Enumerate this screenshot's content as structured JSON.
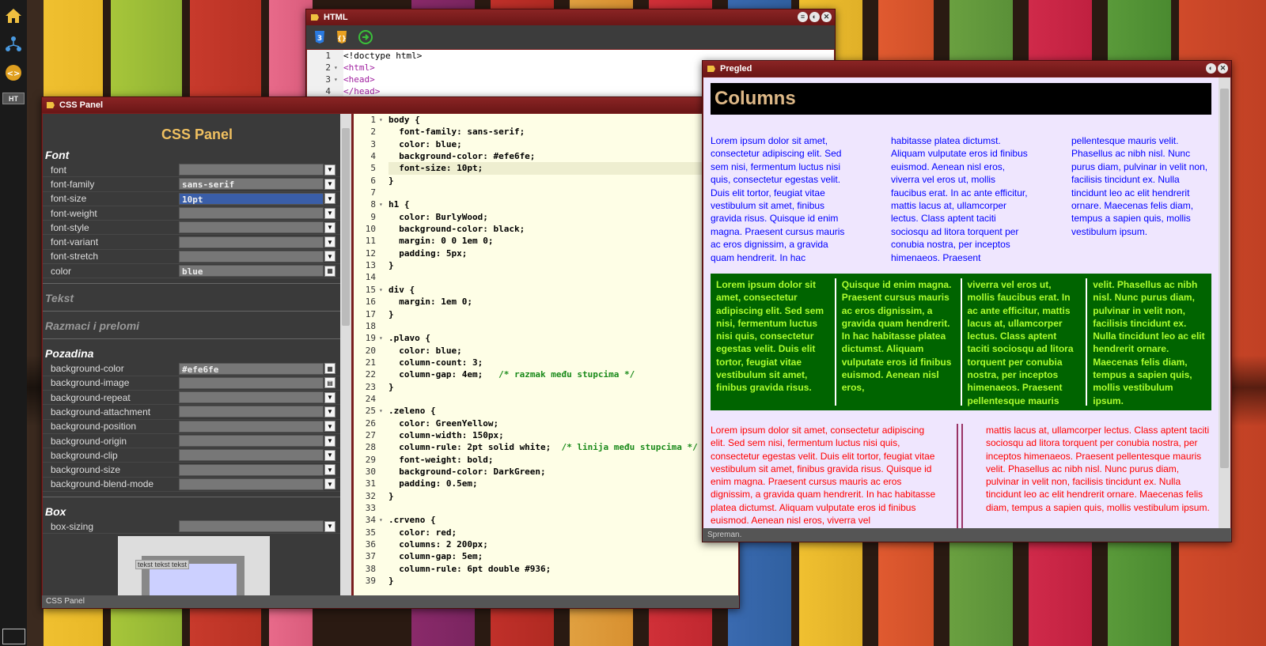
{
  "windows": {
    "html_title": "HTML",
    "css_title": "CSS Panel",
    "preview_title": "Pregled"
  },
  "dock": {
    "ht_label": "HT"
  },
  "html_editor": {
    "lines": [
      "<!doctype html>",
      "<html>",
      "<head>",
      "</head>"
    ]
  },
  "css_panel": {
    "heading": "CSS Panel",
    "font_section": "Font",
    "font_props": [
      {
        "label": "font",
        "value": ""
      },
      {
        "label": "font-family",
        "value": "sans-serif"
      },
      {
        "label": "font-size",
        "value": "10pt"
      },
      {
        "label": "font-weight",
        "value": ""
      },
      {
        "label": "font-style",
        "value": ""
      },
      {
        "label": "font-variant",
        "value": ""
      },
      {
        "label": "font-stretch",
        "value": ""
      },
      {
        "label": "color",
        "value": "blue"
      }
    ],
    "tekst_section": "Tekst",
    "razmaci_section": "Razmaci i prelomi",
    "pozadina_section": "Pozadina",
    "bg_props": [
      {
        "label": "background-color",
        "value": "#efe6fe"
      },
      {
        "label": "background-image",
        "value": ""
      },
      {
        "label": "background-repeat",
        "value": ""
      },
      {
        "label": "background-attachment",
        "value": ""
      },
      {
        "label": "background-position",
        "value": ""
      },
      {
        "label": "background-origin",
        "value": ""
      },
      {
        "label": "background-clip",
        "value": ""
      },
      {
        "label": "background-size",
        "value": ""
      },
      {
        "label": "background-blend-mode",
        "value": ""
      }
    ],
    "box_section": "Box",
    "box_props": [
      {
        "label": "box-sizing",
        "value": ""
      }
    ],
    "box_preview_text": "tekst tekst tekst",
    "status": "CSS Panel"
  },
  "css_code": [
    {
      "n": "1",
      "t": "body {",
      "fold": true
    },
    {
      "n": "2",
      "t": "  font-family: sans-serif;"
    },
    {
      "n": "3",
      "t": "  color: blue;"
    },
    {
      "n": "4",
      "t": "  background-color: #efe6fe;"
    },
    {
      "n": "5",
      "t": "  font-size: 10pt;",
      "hl": true
    },
    {
      "n": "6",
      "t": "}"
    },
    {
      "n": "7",
      "t": ""
    },
    {
      "n": "8",
      "t": "h1 {",
      "fold": true
    },
    {
      "n": "9",
      "t": "  color: BurlyWood;"
    },
    {
      "n": "10",
      "t": "  background-color: black;"
    },
    {
      "n": "11",
      "t": "  margin: 0 0 1em 0;"
    },
    {
      "n": "12",
      "t": "  padding: 5px;"
    },
    {
      "n": "13",
      "t": "}"
    },
    {
      "n": "14",
      "t": ""
    },
    {
      "n": "15",
      "t": "div {",
      "fold": true
    },
    {
      "n": "16",
      "t": "  margin: 1em 0;"
    },
    {
      "n": "17",
      "t": "}"
    },
    {
      "n": "18",
      "t": ""
    },
    {
      "n": "19",
      "t": ".plavo {",
      "fold": true
    },
    {
      "n": "20",
      "t": "  color: blue;"
    },
    {
      "n": "21",
      "t": "  column-count: 3;"
    },
    {
      "n": "22",
      "t": "  column-gap: 4em;   ",
      "c": "/* razmak među stupcima */"
    },
    {
      "n": "23",
      "t": "}"
    },
    {
      "n": "24",
      "t": ""
    },
    {
      "n": "25",
      "t": ".zeleno {",
      "fold": true
    },
    {
      "n": "26",
      "t": "  color: GreenYellow;"
    },
    {
      "n": "27",
      "t": "  column-width: 150px;"
    },
    {
      "n": "28",
      "t": "  column-rule: 2pt solid white;  ",
      "c": "/* linija među stupcima */"
    },
    {
      "n": "29",
      "t": "  font-weight: bold;"
    },
    {
      "n": "30",
      "t": "  background-color: DarkGreen;"
    },
    {
      "n": "31",
      "t": "  padding: 0.5em;"
    },
    {
      "n": "32",
      "t": "}"
    },
    {
      "n": "33",
      "t": ""
    },
    {
      "n": "34",
      "t": ".crveno {",
      "fold": true
    },
    {
      "n": "35",
      "t": "  color: red;"
    },
    {
      "n": "36",
      "t": "  columns: 2 200px;"
    },
    {
      "n": "37",
      "t": "  column-gap: 5em;"
    },
    {
      "n": "38",
      "t": "  column-rule: 6pt double #936;"
    },
    {
      "n": "39",
      "t": "}"
    }
  ],
  "preview": {
    "heading": "Columns",
    "blue_cols": [
      "Lorem ipsum dolor sit amet, consectetur adipiscing elit. Sed sem nisi, fermentum luctus nisi quis, consectetur egestas velit. Duis elit tortor, feugiat vitae vestibulum sit amet, finibus gravida risus. Quisque id enim magna. Praesent cursus mauris ac eros dignissim, a gravida quam hendrerit. In hac",
      "habitasse platea dictumst. Aliquam vulputate eros id finibus euismod. Aenean nisl eros, viverra vel eros ut, mollis faucibus erat. In ac ante efficitur, mattis lacus at, ullamcorper lectus. Class aptent taciti sociosqu ad litora torquent per conubia nostra, per inceptos himenaeos. Praesent",
      "pellentesque mauris velit. Phasellus ac nibh nisl. Nunc purus diam, pulvinar in velit non, facilisis tincidunt ex. Nulla tincidunt leo ac elit hendrerit ornare. Maecenas felis diam, tempus a sapien quis, mollis vestibulum ipsum."
    ],
    "green_cols": [
      "Lorem ipsum dolor sit amet, consectetur adipiscing elit. Sed sem nisi, fermentum luctus nisi quis, consectetur egestas velit. Duis elit tortor, feugiat vitae vestibulum sit amet, finibus gravida risus.",
      "Quisque id enim magna. Praesent cursus mauris ac eros dignissim, a gravida quam hendrerit. In hac habitasse platea dictumst. Aliquam vulputate eros id finibus euismod. Aenean nisl eros,",
      "viverra vel eros ut, mollis faucibus erat. In ac ante efficitur, mattis lacus at, ullamcorper lectus. Class aptent taciti sociosqu ad litora torquent per conubia nostra, per inceptos himenaeos. Praesent pellentesque mauris",
      "velit. Phasellus ac nibh nisl. Nunc purus diam, pulvinar in velit non, facilisis tincidunt ex. Nulla tincidunt leo ac elit hendrerit ornare. Maecenas felis diam, tempus a sapien quis, mollis vestibulum ipsum."
    ],
    "red_cols": [
      "Lorem ipsum dolor sit amet, consectetur adipiscing elit. Sed sem nisi, fermentum luctus nisi quis, consectetur egestas velit. Duis elit tortor, feugiat vitae vestibulum sit amet, finibus gravida risus. Quisque id enim magna. Praesent cursus mauris ac eros dignissim, a gravida quam hendrerit. In hac habitasse platea dictumst. Aliquam vulputate eros id finibus euismod. Aenean nisl eros, viverra vel",
      "mattis lacus at, ullamcorper lectus. Class aptent taciti sociosqu ad litora torquent per conubia nostra, per inceptos himenaeos. Praesent pellentesque mauris velit. Phasellus ac nibh nisl. Nunc purus diam, pulvinar in velit non, facilisis tincidunt ex. Nulla tincidunt leo ac elit hendrerit ornare. Maecenas felis diam, tempus a sapien quis, mollis vestibulum ipsum."
    ],
    "status": "Spreman."
  },
  "colors": {
    "window_frame": "#7a1e1e",
    "preview_bg": "#efe6fe",
    "editor_bg": "#fefee6"
  }
}
